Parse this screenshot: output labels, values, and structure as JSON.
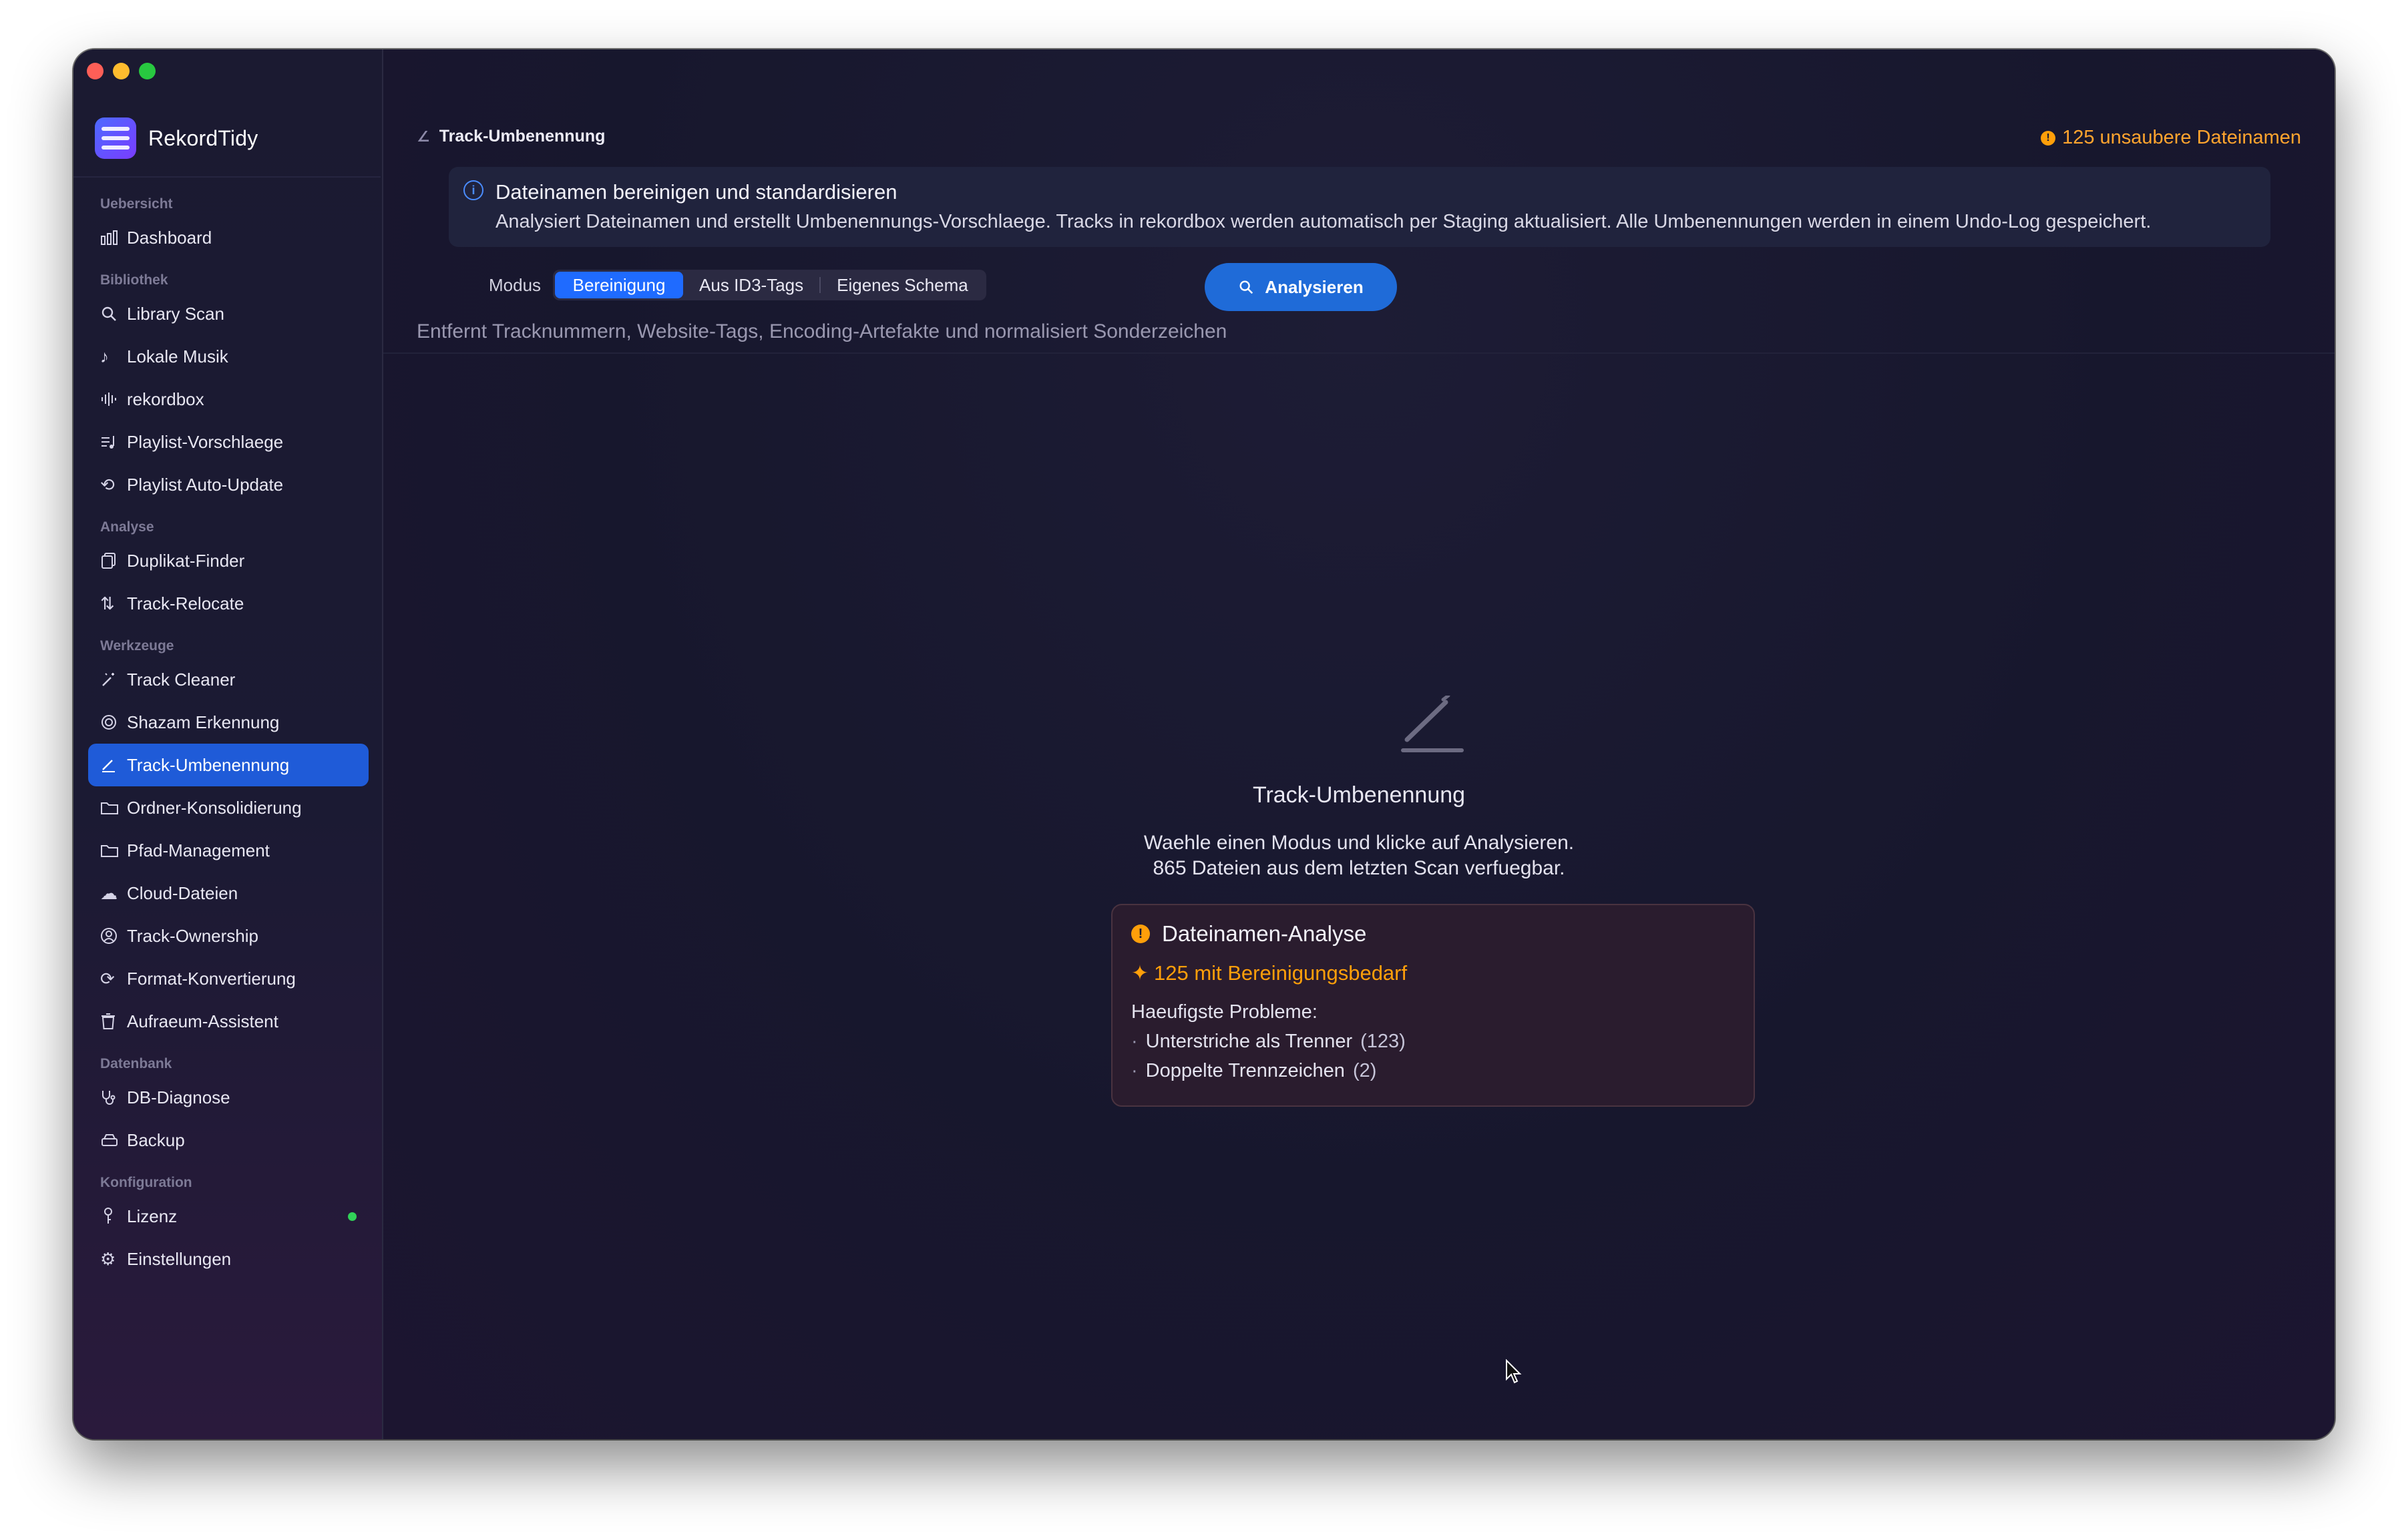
{
  "app": {
    "name": "RekordTidy"
  },
  "sidebar": {
    "sections": [
      {
        "title": "Uebersicht",
        "items": [
          {
            "label": "Dashboard",
            "icon": "bar-chart-icon"
          }
        ]
      },
      {
        "title": "Bibliothek",
        "items": [
          {
            "label": "Library Scan",
            "icon": "search-icon"
          },
          {
            "label": "Lokale Musik",
            "icon": "music-note-icon"
          },
          {
            "label": "rekordbox",
            "icon": "waveform-icon"
          },
          {
            "label": "Playlist-Vorschlaege",
            "icon": "playlist-icon"
          },
          {
            "label": "Playlist Auto-Update",
            "icon": "repeat-icon"
          }
        ]
      },
      {
        "title": "Analyse",
        "items": [
          {
            "label": "Duplikat-Finder",
            "icon": "duplicate-icon"
          },
          {
            "label": "Track-Relocate",
            "icon": "relocate-icon"
          }
        ]
      },
      {
        "title": "Werkzeuge",
        "items": [
          {
            "label": "Track Cleaner",
            "icon": "magic-wand-icon"
          },
          {
            "label": "Shazam Erkennung",
            "icon": "shazam-icon"
          },
          {
            "label": "Track-Umbenennung",
            "icon": "pencil-icon",
            "active": true
          },
          {
            "label": "Ordner-Konsolidierung",
            "icon": "folder-icon"
          },
          {
            "label": "Pfad-Management",
            "icon": "folder-icon"
          },
          {
            "label": "Cloud-Dateien",
            "icon": "cloud-icon"
          },
          {
            "label": "Track-Ownership",
            "icon": "person-icon"
          },
          {
            "label": "Format-Konvertierung",
            "icon": "convert-icon"
          },
          {
            "label": "Aufraeum-Assistent",
            "icon": "trash-icon"
          }
        ]
      },
      {
        "title": "Datenbank",
        "items": [
          {
            "label": "DB-Diagnose",
            "icon": "stethoscope-icon"
          },
          {
            "label": "Backup",
            "icon": "backup-icon"
          }
        ]
      },
      {
        "title": "Konfiguration",
        "items": [
          {
            "label": "Lizenz",
            "icon": "key-icon",
            "status_dot": "#31d158"
          },
          {
            "label": "Einstellungen",
            "icon": "gear-icon"
          }
        ]
      }
    ]
  },
  "header": {
    "breadcrumb": "Track-Umbenennung",
    "warning": "125 unsaubere Dateinamen"
  },
  "info": {
    "title": "Dateinamen bereinigen und standardisieren",
    "description": "Analysiert Dateinamen und erstellt Umbenennungs-Vorschlaege. Tracks in rekordbox werden automatisch per Staging aktualisiert. Alle Umbenennungen werden in einem Undo-Log gespeichert."
  },
  "mode": {
    "label": "Modus",
    "options": [
      "Bereinigung",
      "Aus ID3-Tags",
      "Eigenes Schema"
    ],
    "selected": "Bereinigung",
    "hint": "Entfernt Tracknummern, Website-Tags, Encoding-Artefakte und normalisiert Sonderzeichen"
  },
  "analyse_button": "Analysieren",
  "empty_state": {
    "title": "Track-Umbenennung",
    "line1": "Waehle einen Modus und klicke auf Analysieren.",
    "line2": "865 Dateien aus dem letzten Scan verfuegbar."
  },
  "analysis_card": {
    "title": "Dateinamen-Analyse",
    "count": "125 mit Bereinigungsbedarf",
    "problems_label": "Haeufigste Probleme:",
    "problems": [
      {
        "label": "Unterstriche als Trenner",
        "count": "(123)"
      },
      {
        "label": "Doppelte Trennzeichen",
        "count": "(2)"
      }
    ]
  },
  "colors": {
    "accent": "#1f6bff",
    "active_nav": "#1f5bd8",
    "warning": "#ff9f0a",
    "status_ok": "#31d158"
  }
}
